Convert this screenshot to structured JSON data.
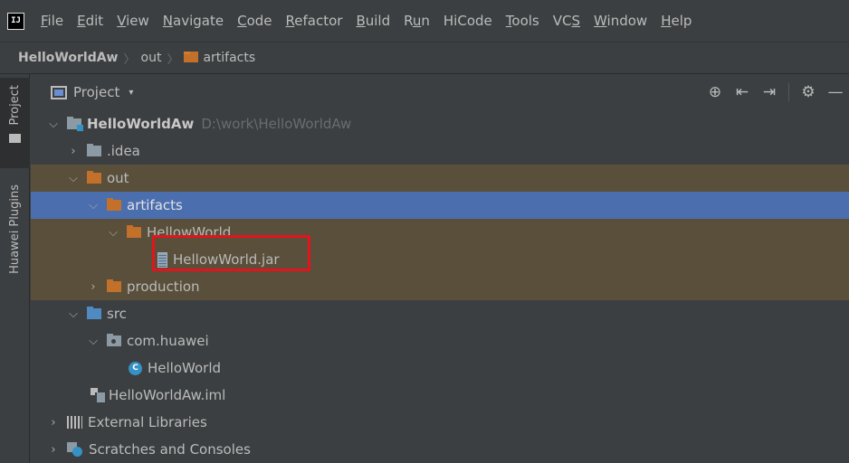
{
  "menubar": {
    "logo_text": "IJ",
    "items": [
      {
        "mnemonic": "F",
        "rest": "ile"
      },
      {
        "mnemonic": "E",
        "rest": "dit"
      },
      {
        "mnemonic": "V",
        "rest": "iew"
      },
      {
        "mnemonic": "N",
        "rest": "avigate"
      },
      {
        "mnemonic": "C",
        "rest": "ode"
      },
      {
        "mnemonic": "R",
        "rest": "efactor"
      },
      {
        "mnemonic": "B",
        "rest": "uild"
      },
      {
        "pre": "R",
        "mnemonic": "u",
        "rest": "n"
      },
      {
        "label": "HiCode"
      },
      {
        "mnemonic": "T",
        "rest": "ools"
      },
      {
        "pre": "VC",
        "mnemonic": "S",
        "rest": ""
      },
      {
        "mnemonic": "W",
        "rest": "indow"
      },
      {
        "mnemonic": "H",
        "rest": "elp"
      }
    ]
  },
  "breadcrumb": {
    "project": "HelloWorldAw",
    "dir1": "out",
    "dir2": "artifacts",
    "separator": "〉"
  },
  "left_stripe": {
    "project_tab": "Project",
    "huawei_tab": "Huawei Plugins"
  },
  "panel": {
    "title": "Project",
    "caret": "▾",
    "tools": [
      "⊕",
      "⇤",
      "⇥",
      "⚙",
      "—"
    ]
  },
  "tree": {
    "rows": [
      {
        "label": "HelloWorldAw",
        "path": "D:\\work\\HelloWorldAw"
      },
      {
        "label": ".idea"
      },
      {
        "label": "out"
      },
      {
        "label": "artifacts"
      },
      {
        "label": "HellowWorld"
      },
      {
        "label": "HellowWorld.jar"
      },
      {
        "label": "production"
      },
      {
        "label": "src"
      },
      {
        "label": "com.huawei"
      },
      {
        "label": "HelloWorld",
        "icon_text": "C"
      },
      {
        "label": "HelloWorldAw.iml"
      },
      {
        "label": "External Libraries"
      },
      {
        "label": "Scratches and Consoles"
      }
    ]
  },
  "icons": {
    "expanded": "⌵",
    "collapsed": "›"
  },
  "colors": {
    "background": "#3c3f41",
    "selected_row": "#4b6eaf",
    "excluded_row": "#594f3a",
    "folder_orange": "#c2702a",
    "folder_blue": "#4f8ac2",
    "highlight": "#e3141b"
  }
}
